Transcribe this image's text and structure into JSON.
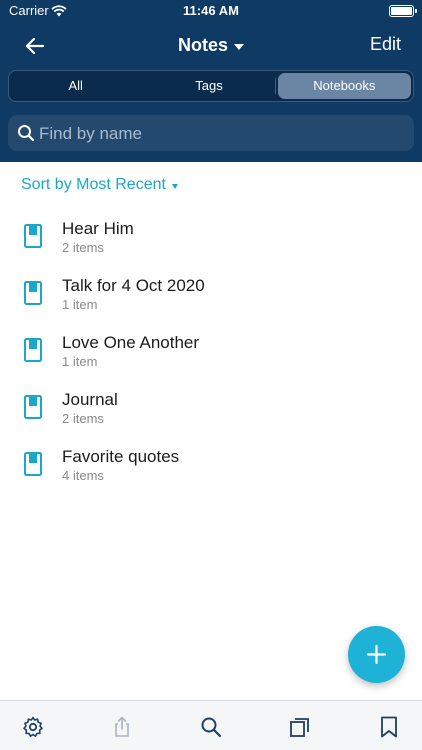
{
  "status_bar": {
    "carrier": "Carrier",
    "time": "11:46 AM"
  },
  "nav": {
    "title": "Notes",
    "edit_label": "Edit"
  },
  "segments": [
    {
      "label": "All",
      "active": false
    },
    {
      "label": "Tags",
      "active": false
    },
    {
      "label": "Notebooks",
      "active": true
    }
  ],
  "search": {
    "placeholder": "Find by name"
  },
  "sort": {
    "label": "Sort by Most Recent"
  },
  "notebooks": [
    {
      "title": "Hear Him",
      "count": "2 items"
    },
    {
      "title": "Talk for 4 Oct 2020",
      "count": "1 item"
    },
    {
      "title": "Love One Another",
      "count": "1 item"
    },
    {
      "title": "Journal",
      "count": "2 items"
    },
    {
      "title": "Favorite quotes",
      "count": "4 items"
    }
  ],
  "colors": {
    "header": "#0f3a63",
    "accent": "#1aa7c9",
    "fab": "#1db2d6"
  },
  "tabbar": {
    "icons": [
      "gear-icon",
      "share-icon",
      "search-icon",
      "copy-icon",
      "bookmark-icon"
    ]
  }
}
